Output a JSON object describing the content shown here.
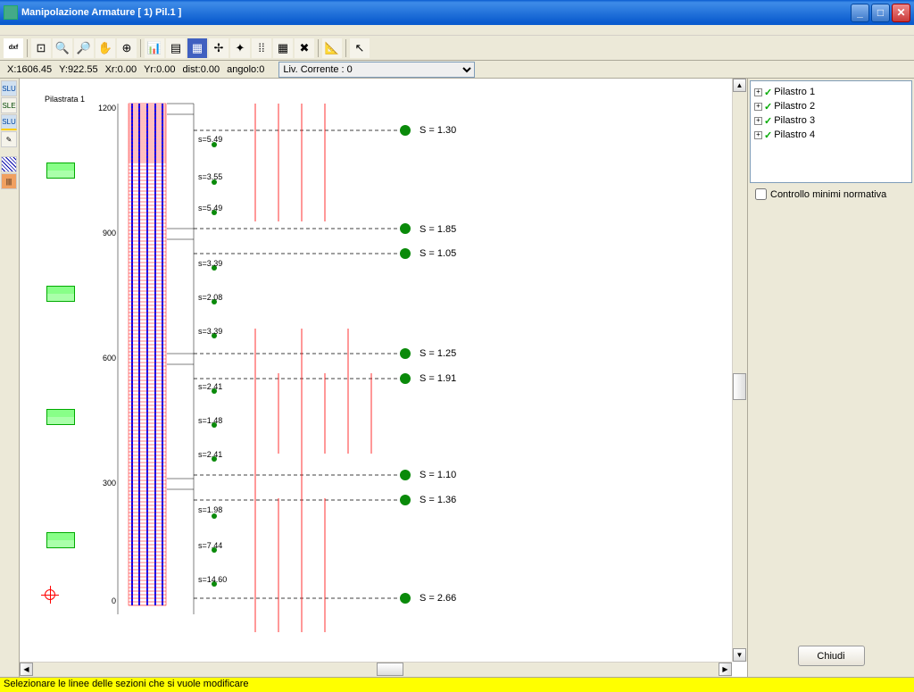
{
  "window": {
    "title": "Manipolazione Armature [  1) Pil.1  ]"
  },
  "coords": {
    "x": "X:1606.45",
    "y": "Y:922.55",
    "xr": "Xr:0.00",
    "yr": "Yr:0.00",
    "dist": "dist:0.00",
    "angolo": "angolo:0",
    "liv_label": "Liv. Corrente : 0"
  },
  "canvas": {
    "title": "Pilastrata  1",
    "y_ticks": [
      {
        "y": 28,
        "label": "1200"
      },
      {
        "y": 168,
        "label": "900"
      },
      {
        "y": 308,
        "label": "600"
      },
      {
        "y": 448,
        "label": "300"
      },
      {
        "y": 580,
        "label": "0"
      }
    ],
    "s_labels_small": [
      {
        "y": 63,
        "label": "s=5.49"
      },
      {
        "y": 105,
        "label": "s=3.55"
      },
      {
        "y": 140,
        "label": "s=5.49"
      },
      {
        "y": 202,
        "label": "s=3.39"
      },
      {
        "y": 240,
        "label": "s=2.08"
      },
      {
        "y": 278,
        "label": "s=3.39"
      },
      {
        "y": 340,
        "label": "s=2.41"
      },
      {
        "y": 378,
        "label": "s=1.48"
      },
      {
        "y": 416,
        "label": "s=2.41"
      },
      {
        "y": 478,
        "label": "s=1.98"
      },
      {
        "y": 518,
        "label": "s=7.44"
      },
      {
        "y": 556,
        "label": "s=14.60"
      }
    ],
    "s_labels_big": [
      {
        "y": 52,
        "label": "S =  1.30"
      },
      {
        "y": 163,
        "label": "S =  1.85"
      },
      {
        "y": 190,
        "label": "S =  1.05"
      },
      {
        "y": 302,
        "label": "S =  1.25"
      },
      {
        "y": 330,
        "label": "S =  1.91"
      },
      {
        "y": 438,
        "label": "S =  1.10"
      },
      {
        "y": 466,
        "label": "S =  1.36"
      },
      {
        "y": 576,
        "label": "S =  2.66"
      }
    ]
  },
  "tree": {
    "items": [
      "Pilastro 1",
      "Pilastro 2",
      "Pilastro 3",
      "Pilastro 4"
    ]
  },
  "checkbox": {
    "label": "Controllo minimi normativa"
  },
  "buttons": {
    "close": "Chiudi"
  },
  "status": {
    "text": "Selezionare le linee delle sezioni che si vuole modificare"
  }
}
